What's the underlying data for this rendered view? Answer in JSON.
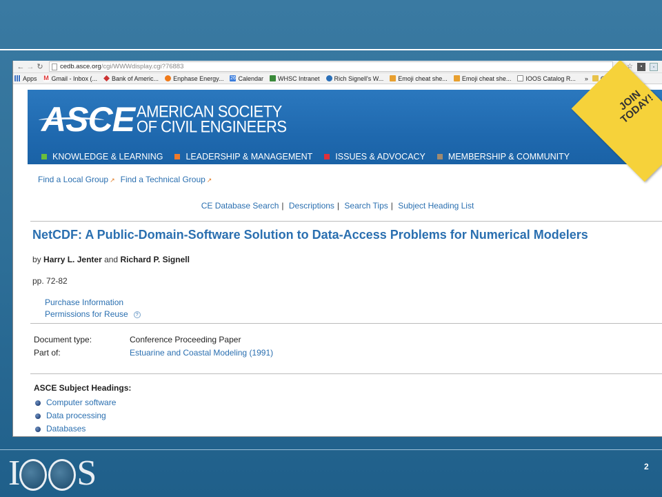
{
  "browser": {
    "url_host": "cedb.asce.org",
    "url_path": "/cgi/WWWdisplay.cgi?76883",
    "bookmarks": [
      {
        "label": "Apps",
        "icon": "apps-icon"
      },
      {
        "label": "Gmail - Inbox (...",
        "icon": "gmail-icon"
      },
      {
        "label": "Bank of Americ...",
        "icon": "bank-icon"
      },
      {
        "label": "Enphase Energy...",
        "icon": "enphase-icon"
      },
      {
        "label": "Calendar",
        "icon": "calendar-icon"
      },
      {
        "label": "WHSC Intranet",
        "icon": "whsc-icon"
      },
      {
        "label": "Rich Signell's W...",
        "icon": "site-icon"
      },
      {
        "label": "Emoji cheat she...",
        "icon": "emoji-icon"
      },
      {
        "label": "Emoji cheat she...",
        "icon": "emoji-icon"
      },
      {
        "label": "IOOS Catalog R...",
        "icon": "document-icon"
      }
    ],
    "more_label": "»",
    "other_bookmarks": "Other bookm",
    "calendar_badge": "26",
    "gmail_badge": "M"
  },
  "asce": {
    "logo": "ASCE",
    "name_line1": "AMERICAN SOCIETY",
    "name_line2": "OF CIVIL ENGINEERS",
    "join_line1": "JOIN",
    "join_line2": "TODAY!",
    "nav": [
      {
        "label": "KNOWLEDGE & LEARNING",
        "color": "#6bbf3a"
      },
      {
        "label": "LEADERSHIP & MANAGEMENT",
        "color": "#f07a2a"
      },
      {
        "label": "ISSUES & ADVOCACY",
        "color": "#e0303a"
      },
      {
        "label": "MEMBERSHIP & COMMUNITY",
        "color": "#a08a70"
      }
    ],
    "subnav": [
      "Find a Local Group",
      "Find a Technical Group"
    ],
    "db_links": [
      "CE Database Search",
      "Descriptions",
      "Search Tips",
      "Subject Heading List"
    ]
  },
  "record": {
    "title": "NetCDF: A Public-Domain-Software Solution to Data-Access Problems for Numerical Modelers",
    "by": "by",
    "author1": "Harry L. Jenter",
    "and": "and",
    "author2": "Richard P. Signell",
    "pages": "pp. 72-82",
    "purchase": "Purchase Information",
    "permissions": "Permissions for Reuse",
    "doc_type_label": "Document type:",
    "doc_type_value": "Conference Proceeding Paper",
    "part_of_label": "Part of:",
    "part_of_value": "Estuarine and Coastal Modeling (1991)",
    "subject_heading": "ASCE Subject Headings:",
    "subjects": [
      "Computer software",
      "Data processing",
      "Databases"
    ]
  },
  "slide": {
    "logo_letter_i": "I",
    "logo_letter_s": "S",
    "page_number": "2"
  }
}
